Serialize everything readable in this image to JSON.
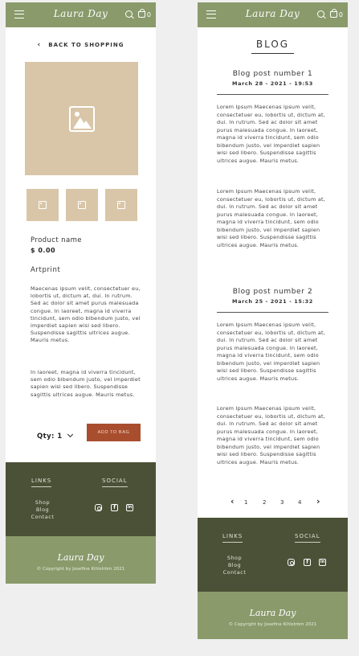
{
  "brand": {
    "logo": "Laura Day",
    "bag_count": "0"
  },
  "product_page": {
    "back_label": "BACK TO SHOPPING",
    "product_name": "Product name",
    "price": "$ 0.00",
    "category": "Artprint",
    "description": [
      "Maecenas ipsum velit, consectetuer eu, lobortis ut, dictum at, dui. In rutrum. Sed ac dolor sit amet purus malesuada congue. In laoreet, magna id viverra tincidunt, sem odio bibendum justo, vel imperdiet sapien wisi sed libero. Suspendisse sagittis ultrices augue. Mauris metus.",
      "In laoreet, magna id viverra tincidunt, sem odio bibendum justo, vel imperdiet sapien wisi sed libero. Suspendisse sagittis ultrices augue. Mauris metus."
    ],
    "qty_label": "Qty: 1",
    "add_button": "ADD TO BAG"
  },
  "blog_page": {
    "title": "BLOG",
    "posts": [
      {
        "title": "Blog post number 1",
        "date": "March 28 - 2021 - 19:53",
        "paragraphs": [
          "Lorem Ipsum Maecenas ipsum velit, consectetuer eu, lobortis ut, dictum at, dui. In rutrum. Sed ac dolor sit amet purus malesuada congue. In laoreet, magna id viverra tincidunt, sem odio bibendum justo, vel imperdiet sapien wisi sed libero. Suspendisse sagittis ultrices augue. Mauris metus.",
          "Lorem Ipsum Maecenas ipsum velit, consectetuer eu, lobortis ut, dictum at, dui. In rutrum. Sed ac dolor sit amet purus malesuada congue. In laoreet, magna id viverra tincidunt, sem odio bibendum justo, vel imperdiet sapien wisi sed libero. Suspendisse sagittis ultrices augue. Mauris metus."
        ]
      },
      {
        "title": "Blog post number 2",
        "date": "March 25 - 2021 - 15:32",
        "paragraphs": [
          "Lorem Ipsum Maecenas ipsum velit, consectetuer eu, lobortis ut, dictum at, dui. In rutrum. Sed ac dolor sit amet purus malesuada congue. In laoreet, magna id viverra tincidunt, sem odio bibendum justo, vel imperdiet sapien wisi sed libero. Suspendisse sagittis ultrices augue. Mauris metus.",
          "Lorem Ipsum Maecenas ipsum velit, consectetuer eu, lobortis ut, dictum at, dui. In rutrum. Sed ac dolor sit amet purus malesuada congue. In laoreet, magna id viverra tincidunt, sem odio bibendum justo, vel imperdiet sapien wisi sed libero. Suspendisse sagittis ultrices augue. Mauris metus."
        ]
      }
    ],
    "pagination": [
      "1",
      "2",
      "3",
      "4"
    ]
  },
  "footer": {
    "links_heading": "LINKS",
    "social_heading": "SOCIAL",
    "links": [
      "Shop",
      "Blog",
      "Contact"
    ],
    "social_icons": [
      "instagram-icon",
      "facebook-icon",
      "linkedin-icon"
    ],
    "logo": "Laura Day",
    "copyright": "© Copyright by Josefine Kihlström 2021"
  },
  "colors": {
    "sage": "#8a9a6b",
    "olive_dark": "#4a5137",
    "sand": "#d9c6a8",
    "rust": "#a84e2e"
  }
}
